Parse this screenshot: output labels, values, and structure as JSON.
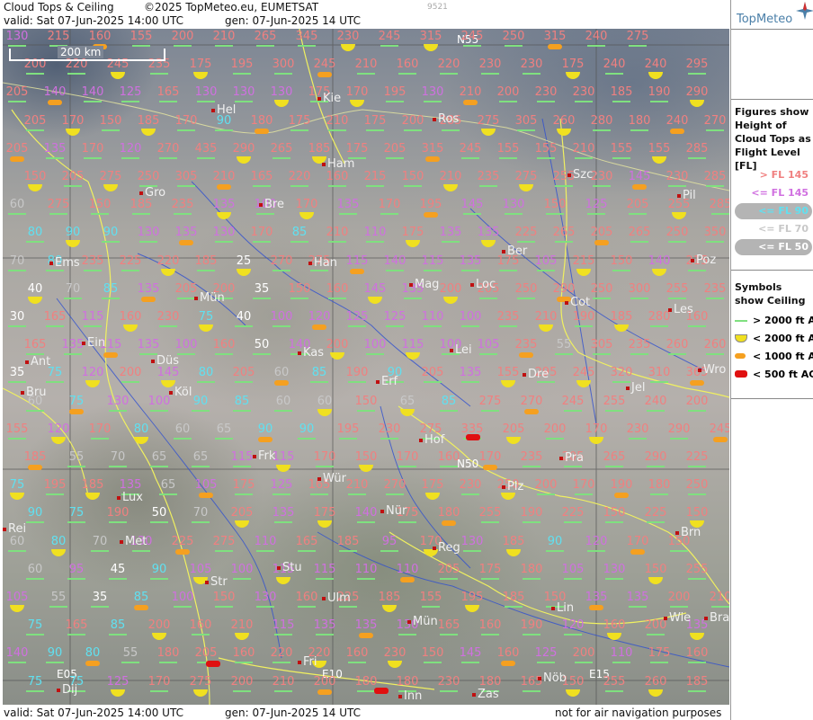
{
  "header": {
    "product": "Cloud Tops & Ceiling",
    "copyright": "©2025 TopMeteo.eu, EUMETSAT",
    "valid": "valid:  Sat  07-Jun-2025  14:00 UTC",
    "generated": "gen: 07-Jun-2025 14 UTC",
    "image_id": "9521"
  },
  "footer": {
    "valid": "valid:  Sat  07-Jun-2025  14:00 UTC",
    "generated": "gen: 07-Jun-2025 14 UTC",
    "disclaimer": "not for air navigation purposes"
  },
  "map": {
    "scale_label": "200 km",
    "grid_labels": {
      "n55": "N55",
      "n50": "N50",
      "e05": "E05",
      "e10": "E10",
      "e15": "E15"
    }
  },
  "legend": {
    "brand": "TopMeteo",
    "tops_title": "Figures show Height of Cloud Tops as Flight Level  [FL]",
    "tops_items": [
      {
        "label": "> FL 145",
        "color": "#f08080",
        "oval": false
      },
      {
        "label": "<= FL 145",
        "color": "#d070e0",
        "oval": false
      },
      {
        "label": "<= FL 90",
        "color": "#60e0f0",
        "oval": true
      },
      {
        "label": "<= FL 70",
        "color": "#c8c8c8",
        "oval": false
      },
      {
        "label": "<= FL 50",
        "color": "#ffffff",
        "oval": true
      }
    ],
    "ceil_title": "Symbols show Ceiling",
    "ceil_items": [
      {
        "label": "> 2000 ft AGL",
        "symbol": "green"
      },
      {
        "label": "< 2000 ft AGL",
        "symbol": "yellow"
      },
      {
        "label": "< 1000 ft AGL",
        "symbol": "orange"
      },
      {
        "label": "< 500 ft AGL",
        "symbol": "red"
      }
    ]
  },
  "colors": {
    "gt145": "#f08080",
    "le145": "#d070e0",
    "le90": "#60e0f0",
    "le70": "#c8c8c8",
    "le50": "#ffffff",
    "border": "#f0f060",
    "river": "#3050d0"
  },
  "cities": [
    "Kie",
    "Hel",
    "Ros",
    "Ham",
    "Szc",
    "Gro",
    "Bre",
    "Pil",
    "Ber",
    "Ems",
    "Han",
    "Mag",
    "Loc",
    "Poz",
    "Mün",
    "Cot",
    "Les",
    "Ein",
    "Kas",
    "Lei",
    "Ant",
    "Düs",
    "Dre",
    "Wro",
    "Bru",
    "Köl",
    "Erf",
    "Jel",
    "Hof",
    "Pra",
    "Frk",
    "Wür",
    "Plz",
    "Lux",
    "Nür",
    "Rei",
    "Met",
    "Reg",
    "Brn",
    "Stu",
    "Str",
    "Ulm",
    "Lin",
    "Mün",
    "Wie",
    "Bra",
    "Fri",
    "Inn",
    "Zas",
    "Dij",
    "Nöb"
  ],
  "grid_rows": [
    [
      "130",
      "215",
      "160",
      "155",
      "200",
      "210",
      "265",
      "345",
      "230",
      "245",
      "315",
      "245",
      "250",
      "315",
      "240",
      "275"
    ],
    [
      "200",
      "220",
      "245",
      "235",
      "175",
      "195",
      "300",
      "245",
      "210",
      "160",
      "220",
      "230",
      "230",
      "175",
      "240",
      "240",
      "295"
    ],
    [
      "205",
      "140",
      "140",
      "125",
      "165",
      "130",
      "130",
      "130",
      "175",
      "170",
      "195",
      "130",
      "210",
      "200",
      "230",
      "230",
      "185",
      "190",
      "290"
    ],
    [
      "205",
      "170",
      "150",
      "185",
      "170",
      "90",
      "180",
      "175",
      "210",
      "175",
      "200",
      "285",
      "275",
      "305",
      "260",
      "280",
      "180",
      "240",
      "270"
    ],
    [
      "205",
      "135",
      "170",
      "120",
      "270",
      "435",
      "290",
      "265",
      "185",
      "175",
      "205",
      "315",
      "245",
      "155",
      "155",
      "210",
      "155",
      "155",
      "285"
    ],
    [
      "150",
      "205",
      "275",
      "250",
      "305",
      "210",
      "165",
      "220",
      "160",
      "215",
      "150",
      "210",
      "235",
      "275",
      "255",
      "230",
      "145",
      "230",
      "285"
    ],
    [
      "60",
      "275",
      "150",
      "185",
      "235",
      "135",
      "100",
      "170",
      "135",
      "170",
      "195",
      "145",
      "130",
      "150",
      "125",
      "205",
      "255",
      "285"
    ],
    [
      "80",
      "90",
      "90",
      "130",
      "135",
      "130",
      "170",
      "85",
      "210",
      "110",
      "175",
      "135",
      "135",
      "225",
      "265",
      "205",
      "265",
      "250",
      "350"
    ],
    [
      "70",
      "80",
      "235",
      "225",
      "220",
      "185",
      "25",
      "270",
      "275",
      "115",
      "140",
      "115",
      "135",
      "175",
      "105",
      "215",
      "150",
      "140",
      "215"
    ],
    [
      "40",
      "70",
      "85",
      "135",
      "205",
      "200",
      "35",
      "150",
      "160",
      "145",
      "135",
      "200",
      "205",
      "250",
      "290",
      "250",
      "300",
      "255",
      "235"
    ],
    [
      "30",
      "165",
      "115",
      "160",
      "230",
      "75",
      "40",
      "100",
      "120",
      "125",
      "125",
      "110",
      "100",
      "235",
      "210",
      "190",
      "185",
      "280",
      "160"
    ],
    [
      "165",
      "135",
      "115",
      "135",
      "100",
      "160",
      "50",
      "140",
      "200",
      "100",
      "115",
      "100",
      "105",
      "235",
      "55",
      "305",
      "235",
      "260",
      "260"
    ],
    [
      "35",
      "75",
      "120",
      "200",
      "145",
      "80",
      "205",
      "60",
      "85",
      "190",
      "90",
      "205",
      "135",
      "155",
      "295",
      "245",
      "320",
      "310",
      "365"
    ],
    [
      "60",
      "75",
      "130",
      "100",
      "90",
      "85",
      "60",
      "60",
      "150",
      "65",
      "85",
      "275",
      "270",
      "245",
      "255",
      "240",
      "200",
      "280"
    ],
    [
      "155",
      "120",
      "170",
      "80",
      "60",
      "65",
      "90",
      "90",
      "195",
      "230",
      "275",
      "335",
      "205",
      "200",
      "170",
      "230",
      "290",
      "245"
    ],
    [
      "185",
      "55",
      "70",
      "65",
      "65",
      "115",
      "115",
      "170",
      "150",
      "170",
      "160",
      "170",
      "235",
      "205",
      "265",
      "290",
      "225"
    ],
    [
      "75",
      "195",
      "185",
      "135",
      "65",
      "105",
      "175",
      "125",
      "165",
      "210",
      "270",
      "175",
      "230",
      "250",
      "200",
      "170",
      "190",
      "180",
      "250"
    ],
    [
      "90",
      "75",
      "190",
      "50",
      "70",
      "205",
      "135",
      "175",
      "140",
      "175",
      "180",
      "255",
      "190",
      "225",
      "150",
      "225",
      "150"
    ],
    [
      "60",
      "80",
      "70",
      "130",
      "225",
      "275",
      "110",
      "165",
      "185",
      "95",
      "170",
      "130",
      "185",
      "90",
      "120",
      "170",
      "150"
    ],
    [
      "60",
      "95",
      "45",
      "90",
      "105",
      "100",
      "115",
      "115",
      "110",
      "110",
      "205",
      "175",
      "180",
      "105",
      "130",
      "150",
      "255",
      "275"
    ],
    [
      "105",
      "55",
      "35",
      "85",
      "100",
      "150",
      "130",
      "160",
      "225",
      "185",
      "155",
      "195",
      "185",
      "150",
      "135",
      "135",
      "200",
      "210"
    ],
    [
      "75",
      "165",
      "85",
      "200",
      "160",
      "210",
      "115",
      "135",
      "135",
      "130",
      "165",
      "160",
      "190",
      "120",
      "160",
      "200",
      "135"
    ],
    [
      "140",
      "90",
      "80",
      "55",
      "180",
      "205",
      "160",
      "220",
      "220",
      "160",
      "230",
      "150",
      "145",
      "160",
      "125",
      "200",
      "110",
      "175",
      "160"
    ],
    [
      "75",
      "75",
      "125",
      "170",
      "275",
      "200",
      "210",
      "200",
      "180",
      "180",
      "230",
      "180",
      "165",
      "150",
      "255",
      "260",
      "185"
    ]
  ]
}
